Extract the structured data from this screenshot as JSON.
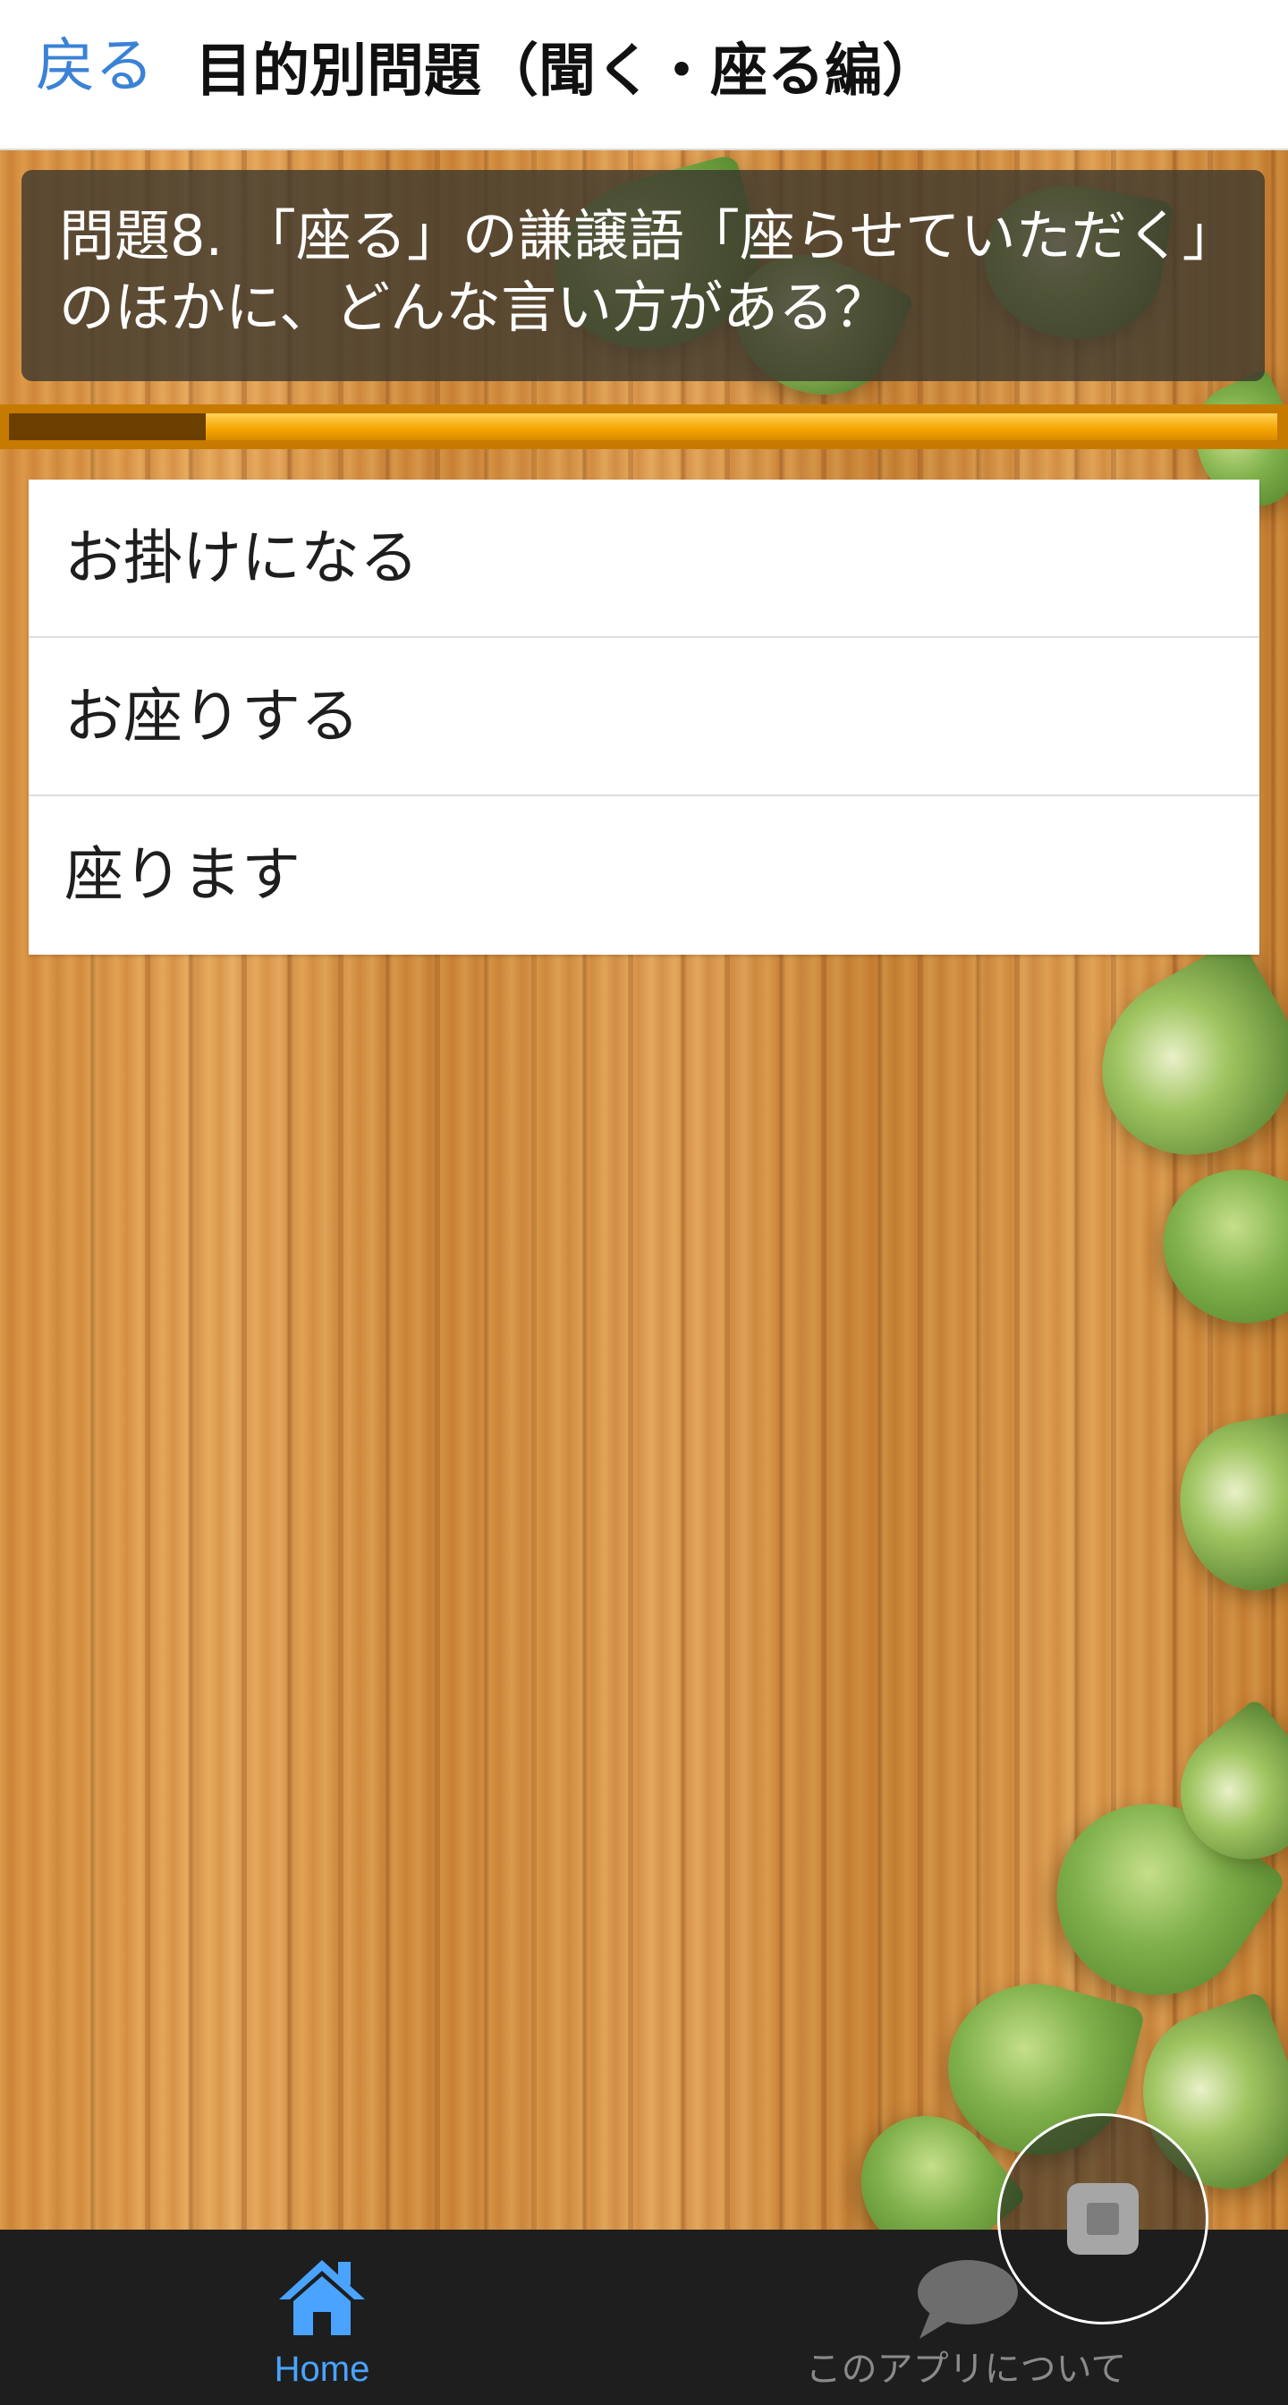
{
  "header": {
    "back_label": "戻る",
    "title": "目的別問題（聞く・座る編）"
  },
  "question": {
    "text": "問題8. 「座る」の謙譲語「座らせていただく」のほかに、どんな言い方がある？"
  },
  "progress": {
    "fraction": 0.155
  },
  "choices": [
    {
      "label": "お掛けになる"
    },
    {
      "label": "お座りする"
    },
    {
      "label": "座ります"
    }
  ],
  "fab": {
    "icon": "stop-icon"
  },
  "tabbar": {
    "tabs": [
      {
        "label": "Home",
        "icon": "home-icon",
        "active": true
      },
      {
        "label": "このアプリについて",
        "icon": "speech-bubble-icon",
        "active": false
      }
    ]
  },
  "colors": {
    "accent": "#3a82d6",
    "tab_active": "#4aa3ff",
    "tab_inactive": "#8a8a8a",
    "progress_fill": "#f4a400",
    "progress_done": "#6b3f00"
  }
}
